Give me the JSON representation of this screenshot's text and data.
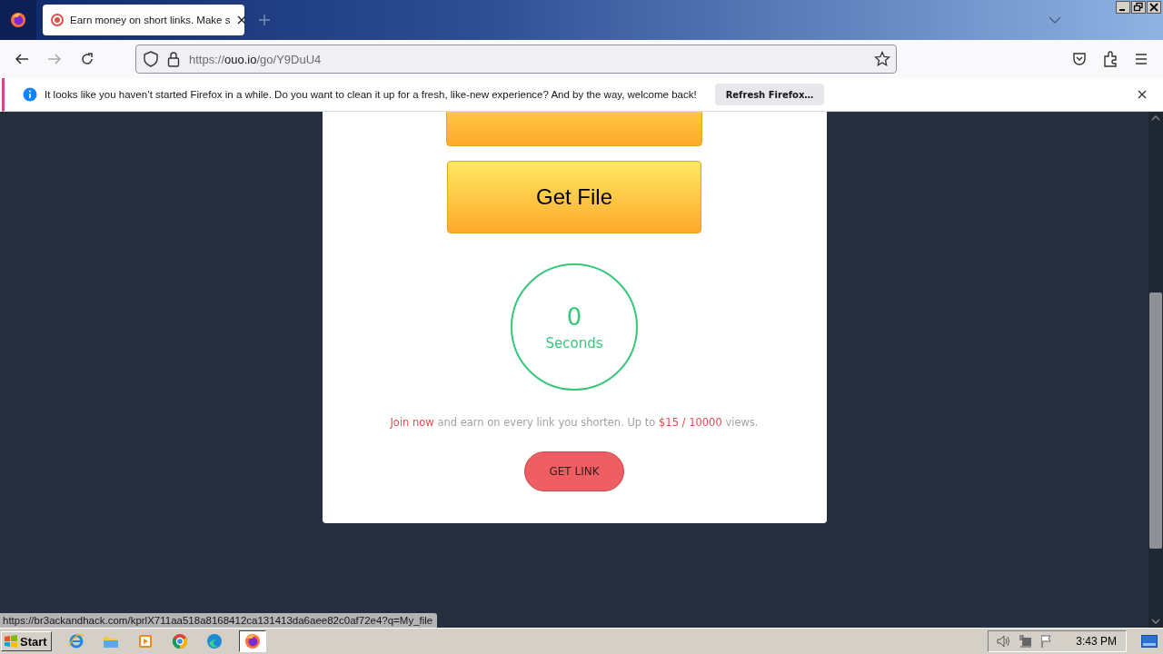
{
  "tabs": [
    {
      "title": "Earn money on short links. Make s",
      "selected": true
    }
  ],
  "address": {
    "scheme": "https://",
    "host": "ouo.io",
    "path": "/go/Y9DuU4"
  },
  "notification": {
    "message": "It looks like you haven’t started Firefox in a while. Do you want to clean it up for a fresh, like-new experience? And by the way, welcome back!",
    "button": "Refresh Firefox…"
  },
  "page": {
    "buttons": [
      {
        "kind": "clipped"
      },
      {
        "kind": "full",
        "label": "Get File"
      }
    ],
    "countdown": {
      "value": "0",
      "unit": "Seconds"
    },
    "promo": [
      {
        "kind": "link",
        "text": "Join now"
      },
      {
        "kind": "plain",
        "text": " and earn on every link you shorten. Up to "
      },
      {
        "kind": "highlight",
        "text": "$15 / 10000"
      },
      {
        "kind": "plain",
        "text": " views."
      }
    ],
    "get_link_button": "GET LINK"
  },
  "status_url": "https://br3ackandhack.com/kprlX711aa518a8168412ca131413da6aee82c0af72e4?q=My_file",
  "taskbar": {
    "start": "Start",
    "apps": [
      {
        "kind": "ie",
        "selected": false
      },
      {
        "kind": "folder",
        "selected": false
      },
      {
        "kind": "media",
        "selected": false
      },
      {
        "kind": "chrome",
        "selected": false
      },
      {
        "kind": "edge",
        "selected": false
      },
      {
        "kind": "firefox",
        "selected": true
      }
    ],
    "clock": "3:43 PM"
  }
}
